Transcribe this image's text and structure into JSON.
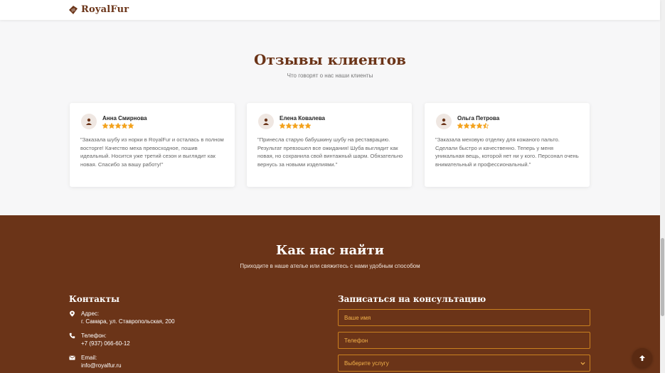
{
  "brand": {
    "name": "RoyalFur",
    "color": "#6b3418",
    "accent": "#f3a21d"
  },
  "reviews": {
    "title": "Отзывы клиентов",
    "subtitle": "Что говорят о нас наши клиенты",
    "items": [
      {
        "name": "Анна Смирнова",
        "rating": 5,
        "text": "\"Заказала шубу из норки в RoyalFur и осталась в полном восторге! Качество меха превосходное, пошив идеальный. Носится уже третий сезон и выглядит как новая. Спасибо за вашу работу!\""
      },
      {
        "name": "Елена Ковалева",
        "rating": 5,
        "text": "\"Принесла старую бабушкину шубу на реставрацию. Результат превзошел все ожидания! Шуба выглядит как новая, но сохранила свой винтажный шарм. Обязательно вернусь за новыми изделиями.\""
      },
      {
        "name": "Ольга Петрова",
        "rating": 4.5,
        "text": "\"Заказала меховую отделку для кожаного пальто. Сделали быстро и качественно. Теперь у меня уникальная вещь, которой нет ни у кого. Персонал очень внимательный и профессиональный.\""
      }
    ]
  },
  "find": {
    "title": "Как нас найти",
    "subtitle": "Приходите в наше ателье или свяжитесь с нами удобным способом",
    "contacts": {
      "title": "Контакты",
      "address_label": "Адрес:",
      "address_value": "г. Самара, ул. Ставропольская, 200",
      "phone_label": "Телефон:",
      "phone_value": "+7 (937) 066-60-12",
      "email_label": "Email:",
      "email_value": "info@royalfur.ru"
    },
    "form": {
      "title": "Записаться на консультацию",
      "name_placeholder": "Ваше имя",
      "phone_placeholder": "Телефон",
      "service_selected": "Выберите услугу"
    }
  },
  "icons": {
    "logo": "logo-icon",
    "avatar": "user-icon",
    "address": "map-pin-icon",
    "phone": "phone-icon",
    "email": "envelope-icon",
    "scroll_top": "arrow-up-icon",
    "select": "chevron-down-icon"
  }
}
